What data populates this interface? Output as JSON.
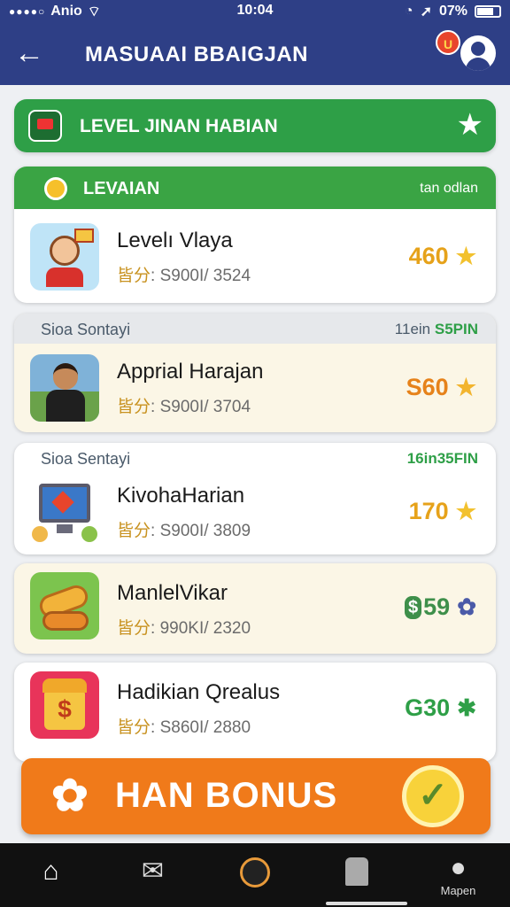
{
  "status_bar": {
    "carrier": "Anio",
    "time": "10:04",
    "battery": "07%"
  },
  "app_bar": {
    "title": "MASUAAI BBAIGJAN",
    "notification_badge": "U"
  },
  "level_banner": {
    "label": "LEVEL JINAN HABIAN"
  },
  "section": {
    "title": "LEVAIAN",
    "subtitle": "tan odlan"
  },
  "rows": [
    {
      "header_left": "",
      "header_right": "",
      "name": "Levelı Vlaya",
      "meta_key": "皆分",
      "meta_value": ": S900I/ 3524",
      "points": "460",
      "points_color": "#e6a21a",
      "icon": "star-icon",
      "bg": "#ffffff"
    },
    {
      "header_left": "Sioa Sontayi",
      "header_right_a": "11ein ",
      "header_right_b": "S5PIN",
      "name": "Apprial Harajan",
      "meta_key": "皆分",
      "meta_value": ": S900I/ 3704",
      "points": "S60",
      "points_color": "#e6821a",
      "icon": "star-icon",
      "bg": "#fbf6e6"
    },
    {
      "header_left": "Sioa Sentayi",
      "header_right_a": "",
      "header_right_b": "16in35FIN",
      "name": "KivohaHarian",
      "meta_key": "皆分",
      "meta_value": ": S900I/ 3809",
      "points": "170",
      "points_color": "#e6a21a",
      "icon": "star-icon",
      "bg": "#ffffff"
    },
    {
      "name": "ManlelVikar",
      "meta_key": "皆分",
      "meta_value": ": 990KI/ 2320",
      "points": "59",
      "points_prefix": "$",
      "points_color": "#3e8f4a",
      "icon": "gear-icon",
      "bg": "#fbf6e6"
    },
    {
      "name": "Hadikian Qrealus",
      "meta_key": "皆分",
      "meta_value": ": S860I/ 2880",
      "points": "G30",
      "points_color": "#2e9f47",
      "icon": "star-icon",
      "bg": "#ffffff"
    }
  ],
  "bonus": {
    "label": "HAN BONUS"
  },
  "bottom_nav": [
    {
      "icon": "home-icon",
      "label": ""
    },
    {
      "icon": "mail-icon",
      "label": ""
    },
    {
      "icon": "circle-icon",
      "label": ""
    },
    {
      "icon": "card-icon",
      "label": ""
    },
    {
      "icon": "profile-icon",
      "label": "Mapen"
    }
  ]
}
